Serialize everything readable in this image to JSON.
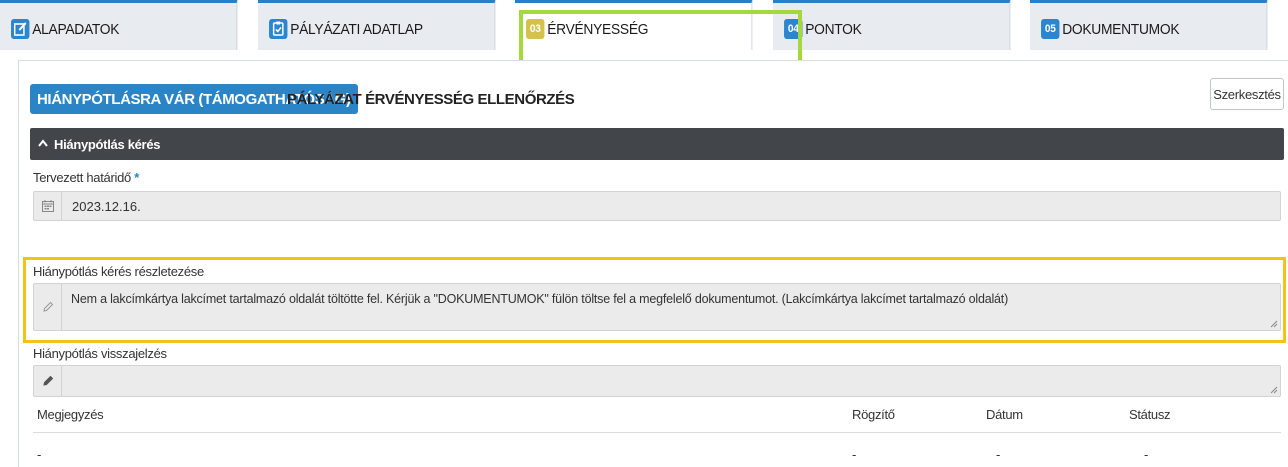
{
  "tabs": [
    {
      "icon": "edit-icon",
      "label": "ALAPADATOK"
    },
    {
      "icon": "clipboard-check-icon",
      "label": "PÁLYÁZATI ADATLAP"
    },
    {
      "badge": "03",
      "label": "ÉRVÉNYESSÉG",
      "active": true
    },
    {
      "badge": "04",
      "label": "PONTOK"
    },
    {
      "badge": "05",
      "label": "DOKUMENTUMOK"
    }
  ],
  "status": {
    "badge_label": "HIÁNYPÓTLÁSRA VÁR (TÁMOGATHATÓSÁG)",
    "section_title": "PÁLYÁZAT ÉRVÉNYESSÉG ELLENŐRZÉS"
  },
  "toolbar": {
    "edit_label": "Szerkesztés"
  },
  "collapsible": {
    "title": "Hiánypótlás kérés"
  },
  "fields": {
    "deadline_label": "Tervezett határidő",
    "deadline_required": "*",
    "deadline_value": "2023.12.16.",
    "details_label": "Hiánypótlás kérés részletezése",
    "details_value": "Nem a lakcímkártya lakcímet tartalmazó oldalát töltötte fel. Kérjük a \"DOKUMENTUMOK\" fülön töltse fel a megfelelő dokumentumot. (Lakcímkártya lakcímet tartalmazó oldalát)",
    "feedback_label": "Hiánypótlás visszajelzés",
    "feedback_value": ""
  },
  "table": {
    "headers": [
      "Megjegyzés",
      "Rögzítő",
      "Dátum",
      "Státusz"
    ],
    "rows": [
      [
        "-",
        "-",
        "-",
        "-"
      ]
    ]
  },
  "colors": {
    "accent": "#2a84c6",
    "green_highlight": "#a5d93b",
    "yellow_highlight": "#f2c419",
    "dark_header": "#424549"
  }
}
